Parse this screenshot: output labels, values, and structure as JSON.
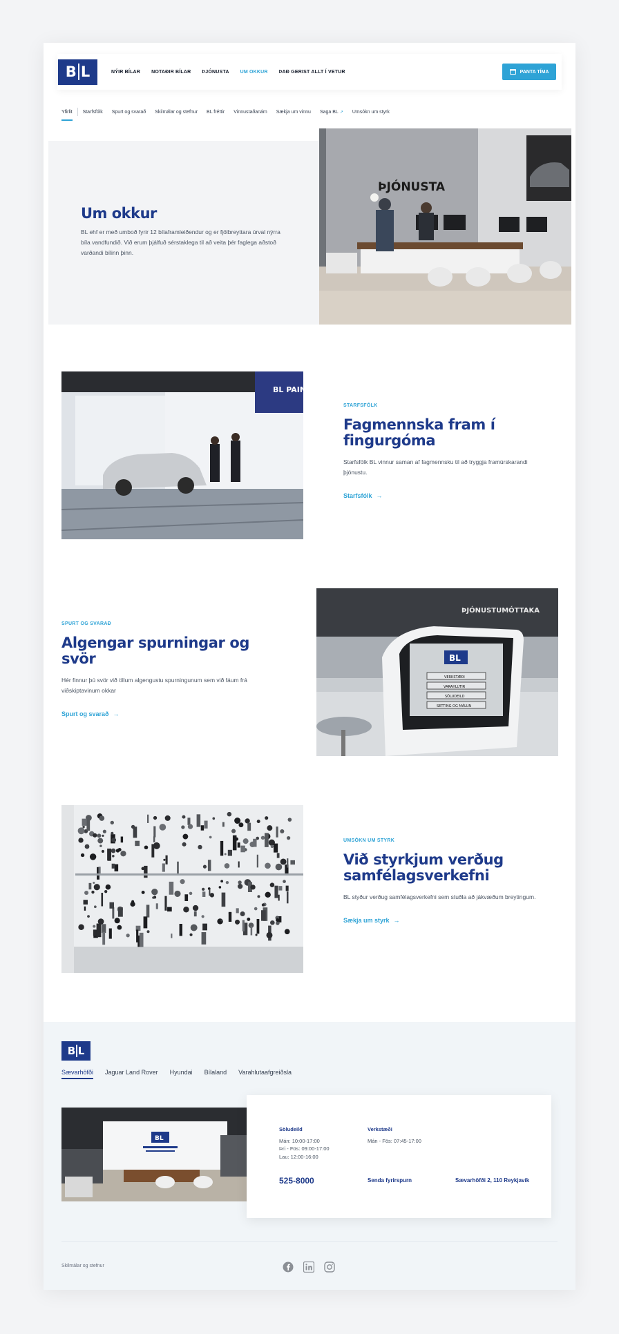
{
  "header": {
    "logo": "BL",
    "nav": [
      "NÝIR BÍLAR",
      "NOTAÐIR BÍLAR",
      "ÞJÓNUSTA",
      "UM OKKUR",
      "ÞAÐ GERIST ALLT Í VETUR"
    ],
    "nav_active_index": 3,
    "booking_button": "PANTA TÍMA"
  },
  "subnav": [
    "Yfirlit",
    "Starfsfólk",
    "Spurt og svarað",
    "Skilmálar og stefnur",
    "BL fréttir",
    "Vinnustaðanám",
    "Sækja um vinnu",
    "Saga BL",
    "Umsókn um styrk"
  ],
  "hero": {
    "title": "Um okkur",
    "text": "BL ehf er með umboð fyrir 12 bílaframleiðendur og er fjölbreyttara úrval nýrra bíla vandfundið. Við erum þjálfuð sérstaklega til að veita þér faglega aðstoð varðandi bílinn þinn.",
    "image_sign": "ÞJÓNUSTA"
  },
  "sections": [
    {
      "kicker": "STARFSFÓLK",
      "title": "Fagmennska fram í fingurgóma",
      "text": "Starfsfólk BL vinnur saman af fagmennsku til að tryggja framúrskarandi þjónustu.",
      "link": "Starfsfólk",
      "image_sign": "BL PAINT MIX"
    },
    {
      "kicker": "SPURT OG SVARAÐ",
      "title": "Algengar spurningar og svör",
      "text": "Hér finnur þú svör við öllum algengustu spurningunum sem við fáum frá viðskiptavinum okkar",
      "link": "Spurt og svarað",
      "image_sign": "ÞJÓNUSTUMÓTTAKA",
      "kiosk_logo": "BL",
      "kiosk_buttons": [
        "VERKSTÆÐI",
        "VARAHLUTIR",
        "SÖLUDEILD",
        "SETTING OG MÁLUN"
      ]
    },
    {
      "kicker": "UMSÓKN UM STYRK",
      "title": "Við styrkjum verðug samfélagsverkefni",
      "text": "BL styður verðug samfélagsverkefni sem stuðla að jákvæðum breytingum.",
      "link": "Sækja um styrk"
    }
  ],
  "footer": {
    "logo": "BL",
    "tabs": [
      "Sævarhöfði",
      "Jaguar Land Rover",
      "Hyundai",
      "Bílaland",
      "Varahlutaafgreiðsla"
    ],
    "tab_active_index": 0,
    "sales": {
      "heading": "Söludeild",
      "lines": [
        "Mán: 10:00-17:00",
        "Þri - Fös: 09:00-17:00",
        "Lau: 12:00-16:00"
      ]
    },
    "workshop": {
      "heading": "Verkstæði",
      "lines": [
        "Mán - Fös: 07:45-17:00"
      ]
    },
    "phone": "525-8000",
    "send_request": "Senda fyrirspurn",
    "address": "Sævarhöfði 2, 110 Reykjavík",
    "terms": "Skilmálar og stefnur",
    "social": [
      "facebook-icon",
      "linkedin-icon",
      "instagram-icon"
    ]
  },
  "colors": {
    "brand_blue": "#1e3a8a",
    "accent": "#2ea3d6",
    "light_bg": "#f3f4f6"
  }
}
